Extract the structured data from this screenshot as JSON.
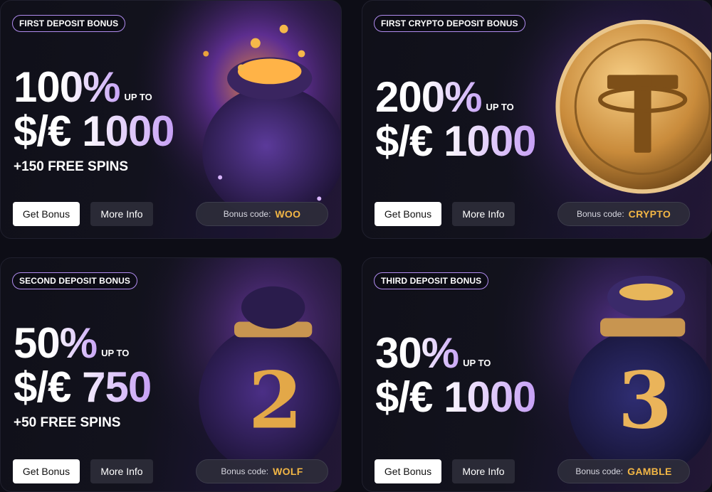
{
  "cards": [
    {
      "badge": "FIRST DEPOSIT BONUS",
      "percent": "100%",
      "upto": "UP TO",
      "amount": "$/€ 1000",
      "spins": "+150 FREE SPINS",
      "get_label": "Get Bonus",
      "info_label": "More Info",
      "code_label": "Bonus code:",
      "code_value": "WOO",
      "art": "coin-bag-icon"
    },
    {
      "badge": "FIRST CRYPTO DEPOSIT BONUS",
      "percent": "200%",
      "upto": "UP TO",
      "amount": "$/€ 1000",
      "spins": "",
      "get_label": "Get Bonus",
      "info_label": "More Info",
      "code_label": "Bonus code:",
      "code_value": "CRYPTO",
      "art": "tether-coin-icon"
    },
    {
      "badge": "SECOND DEPOSIT BONUS",
      "percent": "50%",
      "upto": "UP TO",
      "amount": "$/€ 750",
      "spins": "+50 FREE SPINS",
      "get_label": "Get Bonus",
      "info_label": "More Info",
      "code_label": "Bonus code:",
      "code_value": "WOLF",
      "art": "bag-number-2-icon"
    },
    {
      "badge": "THIRD DEPOSIT BONUS",
      "percent": "30%",
      "upto": "UP TO",
      "amount": "$/€ 1000",
      "spins": "",
      "get_label": "Get Bonus",
      "info_label": "More Info",
      "code_label": "Bonus code:",
      "code_value": "GAMBLE",
      "art": "bag-number-3-icon"
    }
  ],
  "art_numbers": [
    "2",
    "3"
  ],
  "colors": {
    "background": "#0d0d16",
    "accent_purple": "#b18cf0",
    "code_gold": "#f2b645",
    "button_light": "#ffffff",
    "button_dark": "#2a2a36"
  }
}
